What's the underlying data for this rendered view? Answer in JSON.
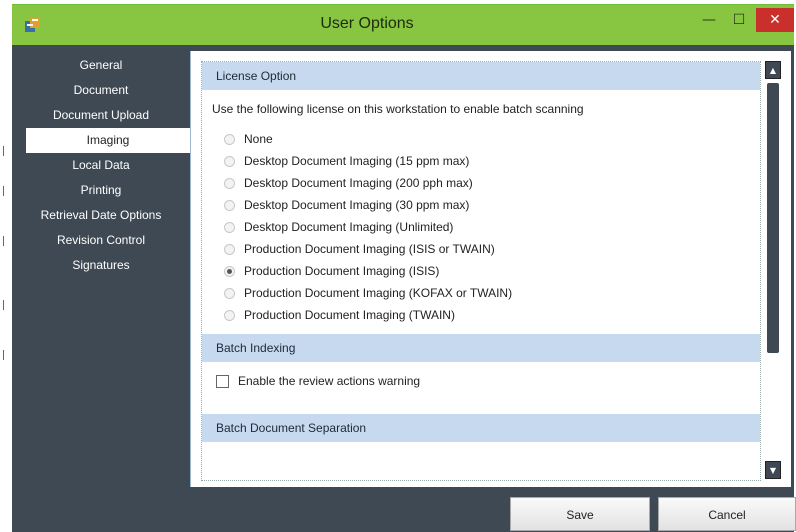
{
  "window": {
    "title": "User Options",
    "close_glyph": "✕",
    "min_glyph": "—",
    "max_glyph": "☐"
  },
  "sidebar": {
    "items": [
      {
        "label": "General"
      },
      {
        "label": "Document"
      },
      {
        "label": "Document Upload"
      },
      {
        "label": "Imaging",
        "selected": true
      },
      {
        "label": "Local Data"
      },
      {
        "label": "Printing"
      },
      {
        "label": "Retrieval Date Options"
      },
      {
        "label": "Revision Control"
      },
      {
        "label": "Signatures"
      }
    ]
  },
  "license": {
    "heading": "License Option",
    "description": "Use the following license on this workstation to enable batch scanning",
    "options": [
      {
        "label": "None",
        "checked": false
      },
      {
        "label": "Desktop Document Imaging (15 ppm max)",
        "checked": false
      },
      {
        "label": "Desktop Document Imaging (200 pph max)",
        "checked": false
      },
      {
        "label": "Desktop Document Imaging (30 ppm max)",
        "checked": false
      },
      {
        "label": "Desktop Document Imaging (Unlimited)",
        "checked": false
      },
      {
        "label": "Production Document Imaging (ISIS or TWAIN)",
        "checked": false
      },
      {
        "label": "Production Document Imaging (ISIS)",
        "checked": true
      },
      {
        "label": "Production Document Imaging (KOFAX or TWAIN)",
        "checked": false
      },
      {
        "label": "Production Document Imaging (TWAIN)",
        "checked": false
      }
    ]
  },
  "batch_indexing": {
    "heading": "Batch Indexing",
    "review_warning_label": "Enable the review actions warning",
    "review_warning_checked": false
  },
  "batch_separation": {
    "heading": "Batch Document Separation"
  },
  "footer": {
    "save_label": "Save",
    "cancel_label": "Cancel"
  },
  "colors": {
    "titlebar": "#88c540",
    "sidebar": "#3f4953",
    "section": "#c6d9ee",
    "close": "#c9302c"
  }
}
